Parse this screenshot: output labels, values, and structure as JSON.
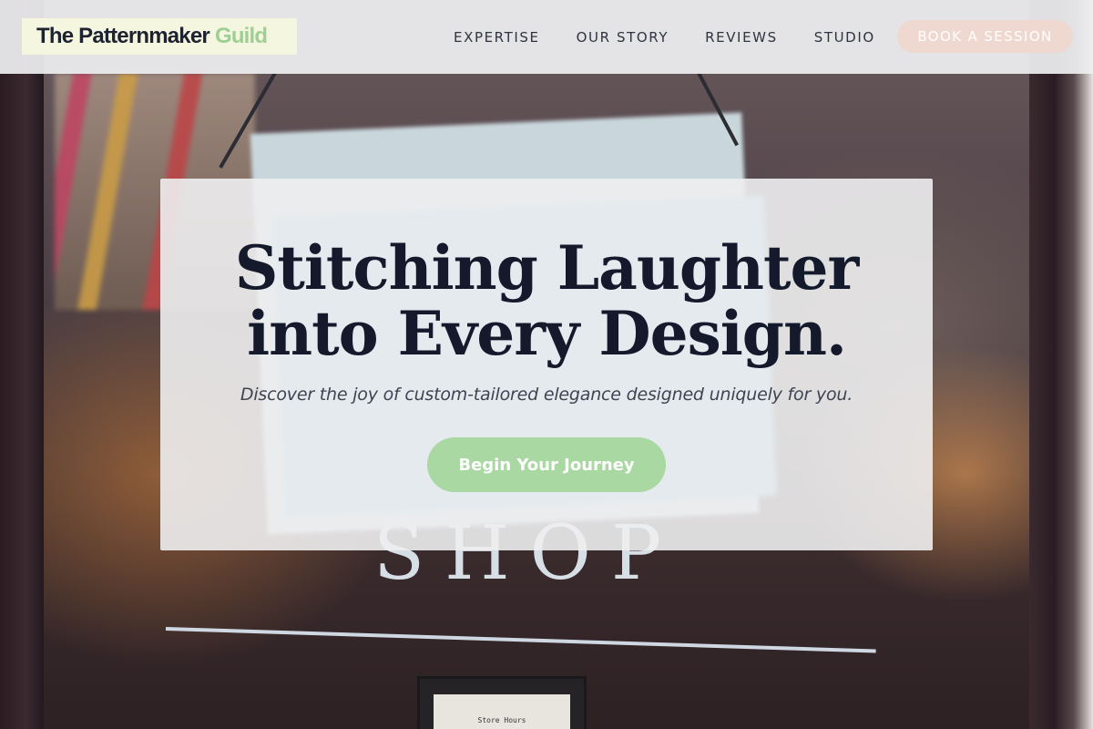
{
  "header": {
    "brand_main": "The Patternmaker",
    "brand_accent": "Guild",
    "nav": [
      {
        "label": "EXPERTISE"
      },
      {
        "label": "OUR STORY"
      },
      {
        "label": "REVIEWS"
      },
      {
        "label": "STUDIO"
      }
    ],
    "cta_label": "BOOK A SESSION"
  },
  "hero": {
    "title_line1": "Stitching Laughter",
    "title_line2": "into Every Design.",
    "subtitle": "Discover the joy of custom-tailored elegance designed uniquely for you.",
    "button_label": "Begin Your Journey"
  },
  "background": {
    "shop_text": "SHOP",
    "card_text": "Store Hours"
  },
  "colors": {
    "brand_accent": "#9ecf95",
    "cta_bg": "#efd8d0",
    "hero_button": "#a9d8a2",
    "title": "#141a2c"
  }
}
